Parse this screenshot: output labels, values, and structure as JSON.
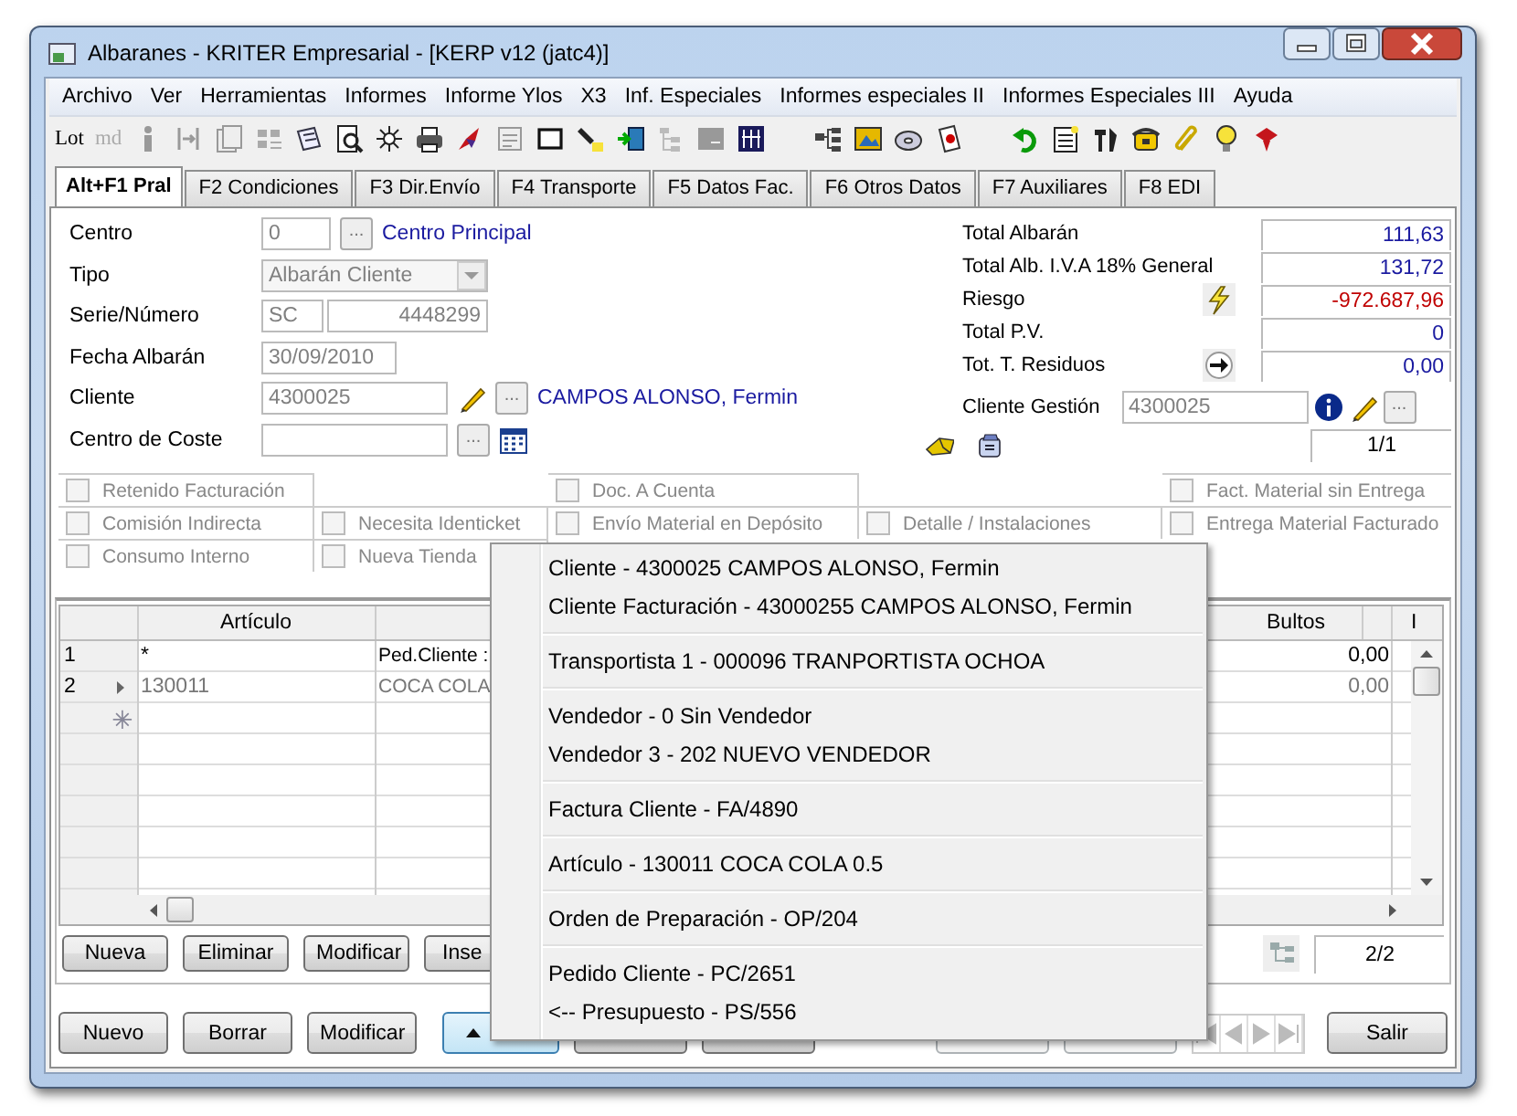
{
  "window": {
    "title": "Albaranes - KRITER Empresarial -  [KERP v12 (jatc4)]"
  },
  "menu": [
    "Archivo",
    "Ver",
    "Herramientas",
    "Informes",
    "Informe Ylos",
    "X3",
    "Inf. Especiales",
    "Informes especiales II",
    "Informes Especiales III",
    "Ayuda"
  ],
  "toolbar": [
    {
      "label": "Lot",
      "disabled": false
    },
    {
      "label": "md",
      "disabled": true
    }
  ],
  "tabs": [
    {
      "label": "Alt+F1 Pral",
      "selected": true
    },
    {
      "label": "F2 Condiciones",
      "selected": false
    },
    {
      "label": "F3 Dir.Envío",
      "selected": false
    },
    {
      "label": "F4 Transporte",
      "selected": false
    },
    {
      "label": "F5 Datos Fac.",
      "selected": false
    },
    {
      "label": "F6 Otros Datos",
      "selected": false
    },
    {
      "label": "F7 Auxiliares",
      "selected": false
    },
    {
      "label": "F8 EDI",
      "selected": false
    }
  ],
  "fields": [
    {
      "kind": "lookup",
      "label": "Centro",
      "value": "0",
      "button": "...",
      "link": "Centro Principal",
      "disabled": true
    },
    {
      "kind": "dropdown",
      "label": "Tipo",
      "value": "Albarán Cliente",
      "disabled": true
    },
    {
      "kind": "pair",
      "label": "Serie/Número",
      "values": [
        "SC",
        "4448299"
      ],
      "disabled": true
    },
    {
      "kind": "text",
      "label": "Fecha Albarán",
      "value": "30/09/2010",
      "disabled": true
    },
    {
      "kind": "lookup_edit",
      "label": "Cliente",
      "value": "4300025",
      "button": "...",
      "link": "CAMPOS ALONSO, Fermin",
      "disabled": true
    },
    {
      "kind": "lookup_calendar",
      "label": "Centro de Coste",
      "button": "..."
    }
  ],
  "totals": [
    {
      "kind": "plain",
      "label": "Total Albarán",
      "value": "111,63",
      "negative": false
    },
    {
      "kind": "plain",
      "label": "Total Alb. I.V.A 18% General",
      "value": "131,72",
      "negative": false
    },
    {
      "kind": "bolt",
      "label": "Riesgo",
      "value": "-972.687,96",
      "negative": true
    },
    {
      "kind": "plain",
      "label": "Total P.V.",
      "value": "0",
      "negative": false
    },
    {
      "kind": "arrow",
      "label": "Tot. T. Residuos",
      "value": "0,00",
      "negative": false
    }
  ],
  "cliente_gestion": {
    "label": "Cliente Gestión",
    "value": "4300025",
    "button": "...",
    "disabled": true
  },
  "record_counter": "1/1",
  "checkboxes": [
    {
      "label": "Retenido Facturación",
      "checked": false
    },
    {
      "label": "Doc. A Cuenta",
      "checked": false
    },
    {
      "label": "Fact. Material sin Entrega",
      "checked": false
    },
    {
      "label": "Comisión Indirecta",
      "checked": false
    },
    {
      "label": "Necesita Identicket",
      "checked": false
    },
    {
      "label": "Envío Material en Depósito",
      "checked": false
    },
    {
      "label": "Detalle / Instalaciones",
      "checked": false
    },
    {
      "label": "Entrega Material Facturado",
      "checked": false
    },
    {
      "label": "Consumo Interno",
      "checked": false
    },
    {
      "label": "Nueva Tienda",
      "checked": false
    }
  ],
  "lines": {
    "columns": [
      "Artículo",
      "Bultos",
      "I"
    ],
    "rows": [
      {
        "number": "1",
        "articulo": "*",
        "column_3": "Ped.Cliente :",
        "bultos": "0,00",
        "current": false
      },
      {
        "number": "2",
        "articulo": "130011",
        "column_3": "COCA COLA",
        "bultos": "0,00",
        "current": true
      }
    ],
    "buttons": [
      "Nueva",
      "Eliminar",
      "Modificar",
      "Inse"
    ],
    "counter": "2/2"
  },
  "buttons": [
    {
      "label": "Nuevo",
      "disabled": false
    },
    {
      "label": "Borrar",
      "disabled": false
    },
    {
      "label": "Modificar",
      "disabled": false
    }
  ],
  "exit_button": "Salir",
  "context_menu": [
    [
      "Cliente - 4300025 CAMPOS ALONSO, Fermin",
      "Cliente Facturación - 43000255 CAMPOS ALONSO, Fermin"
    ],
    [
      "Transportista 1 - 000096 TRANPORTISTA OCHOA"
    ],
    [
      "Vendedor - 0 Sin Vendedor",
      "Vendedor 3 - 202 NUEVO VENDEDOR"
    ],
    [
      "Factura Cliente - FA/4890"
    ],
    [
      "Artículo - 130011 COCA COLA 0.5"
    ],
    [
      "Orden de Preparación - OP/204"
    ],
    [
      "Pedido Cliente - PC/2651",
      "<-- Presupuesto - PS/556"
    ]
  ]
}
